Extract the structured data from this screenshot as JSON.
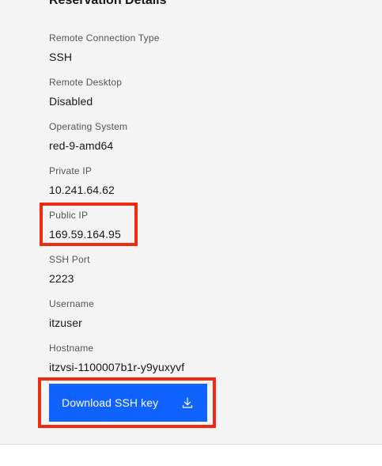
{
  "section": {
    "title": "Reservation Details"
  },
  "fields": [
    {
      "label": "Remote Connection Type",
      "value": "SSH"
    },
    {
      "label": "Remote Desktop",
      "value": "Disabled"
    },
    {
      "label": "Operating System",
      "value": "red-9-amd64"
    },
    {
      "label": "Private IP",
      "value": "10.241.64.62"
    },
    {
      "label": "Public IP",
      "value": "169.59.164.95"
    },
    {
      "label": "SSH Port",
      "value": "2223"
    },
    {
      "label": "Username",
      "value": "itzuser"
    },
    {
      "label": "Hostname",
      "value": "itzvsi-1100007b1r-y9yuxyvf"
    }
  ],
  "actions": {
    "download_ssh_key_label": "Download SSH key",
    "download_icon": "download-icon"
  },
  "colors": {
    "panel_bg": "#f4f4f4",
    "primary_button": "#0f62fe",
    "highlight_box": "#ee2a10"
  }
}
